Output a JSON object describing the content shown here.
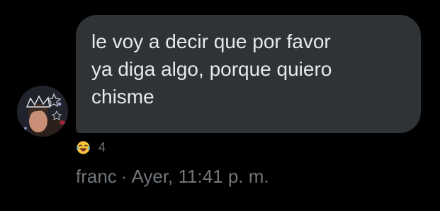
{
  "message": {
    "text_lines": [
      "le voy a decir que por favor",
      "ya diga algo, porque quiero",
      "chisme"
    ],
    "bubble_color": "#2f3336",
    "text_color": "#e7e9ea"
  },
  "reaction": {
    "emoji_icon": "face-with-tears-of-joy-icon",
    "count": "4"
  },
  "meta": {
    "sender": "franc",
    "separator": "·",
    "timestamp": "Ayer, 11:41 p. m."
  },
  "colors": {
    "background": "#000000",
    "muted_text": "#71767b"
  }
}
